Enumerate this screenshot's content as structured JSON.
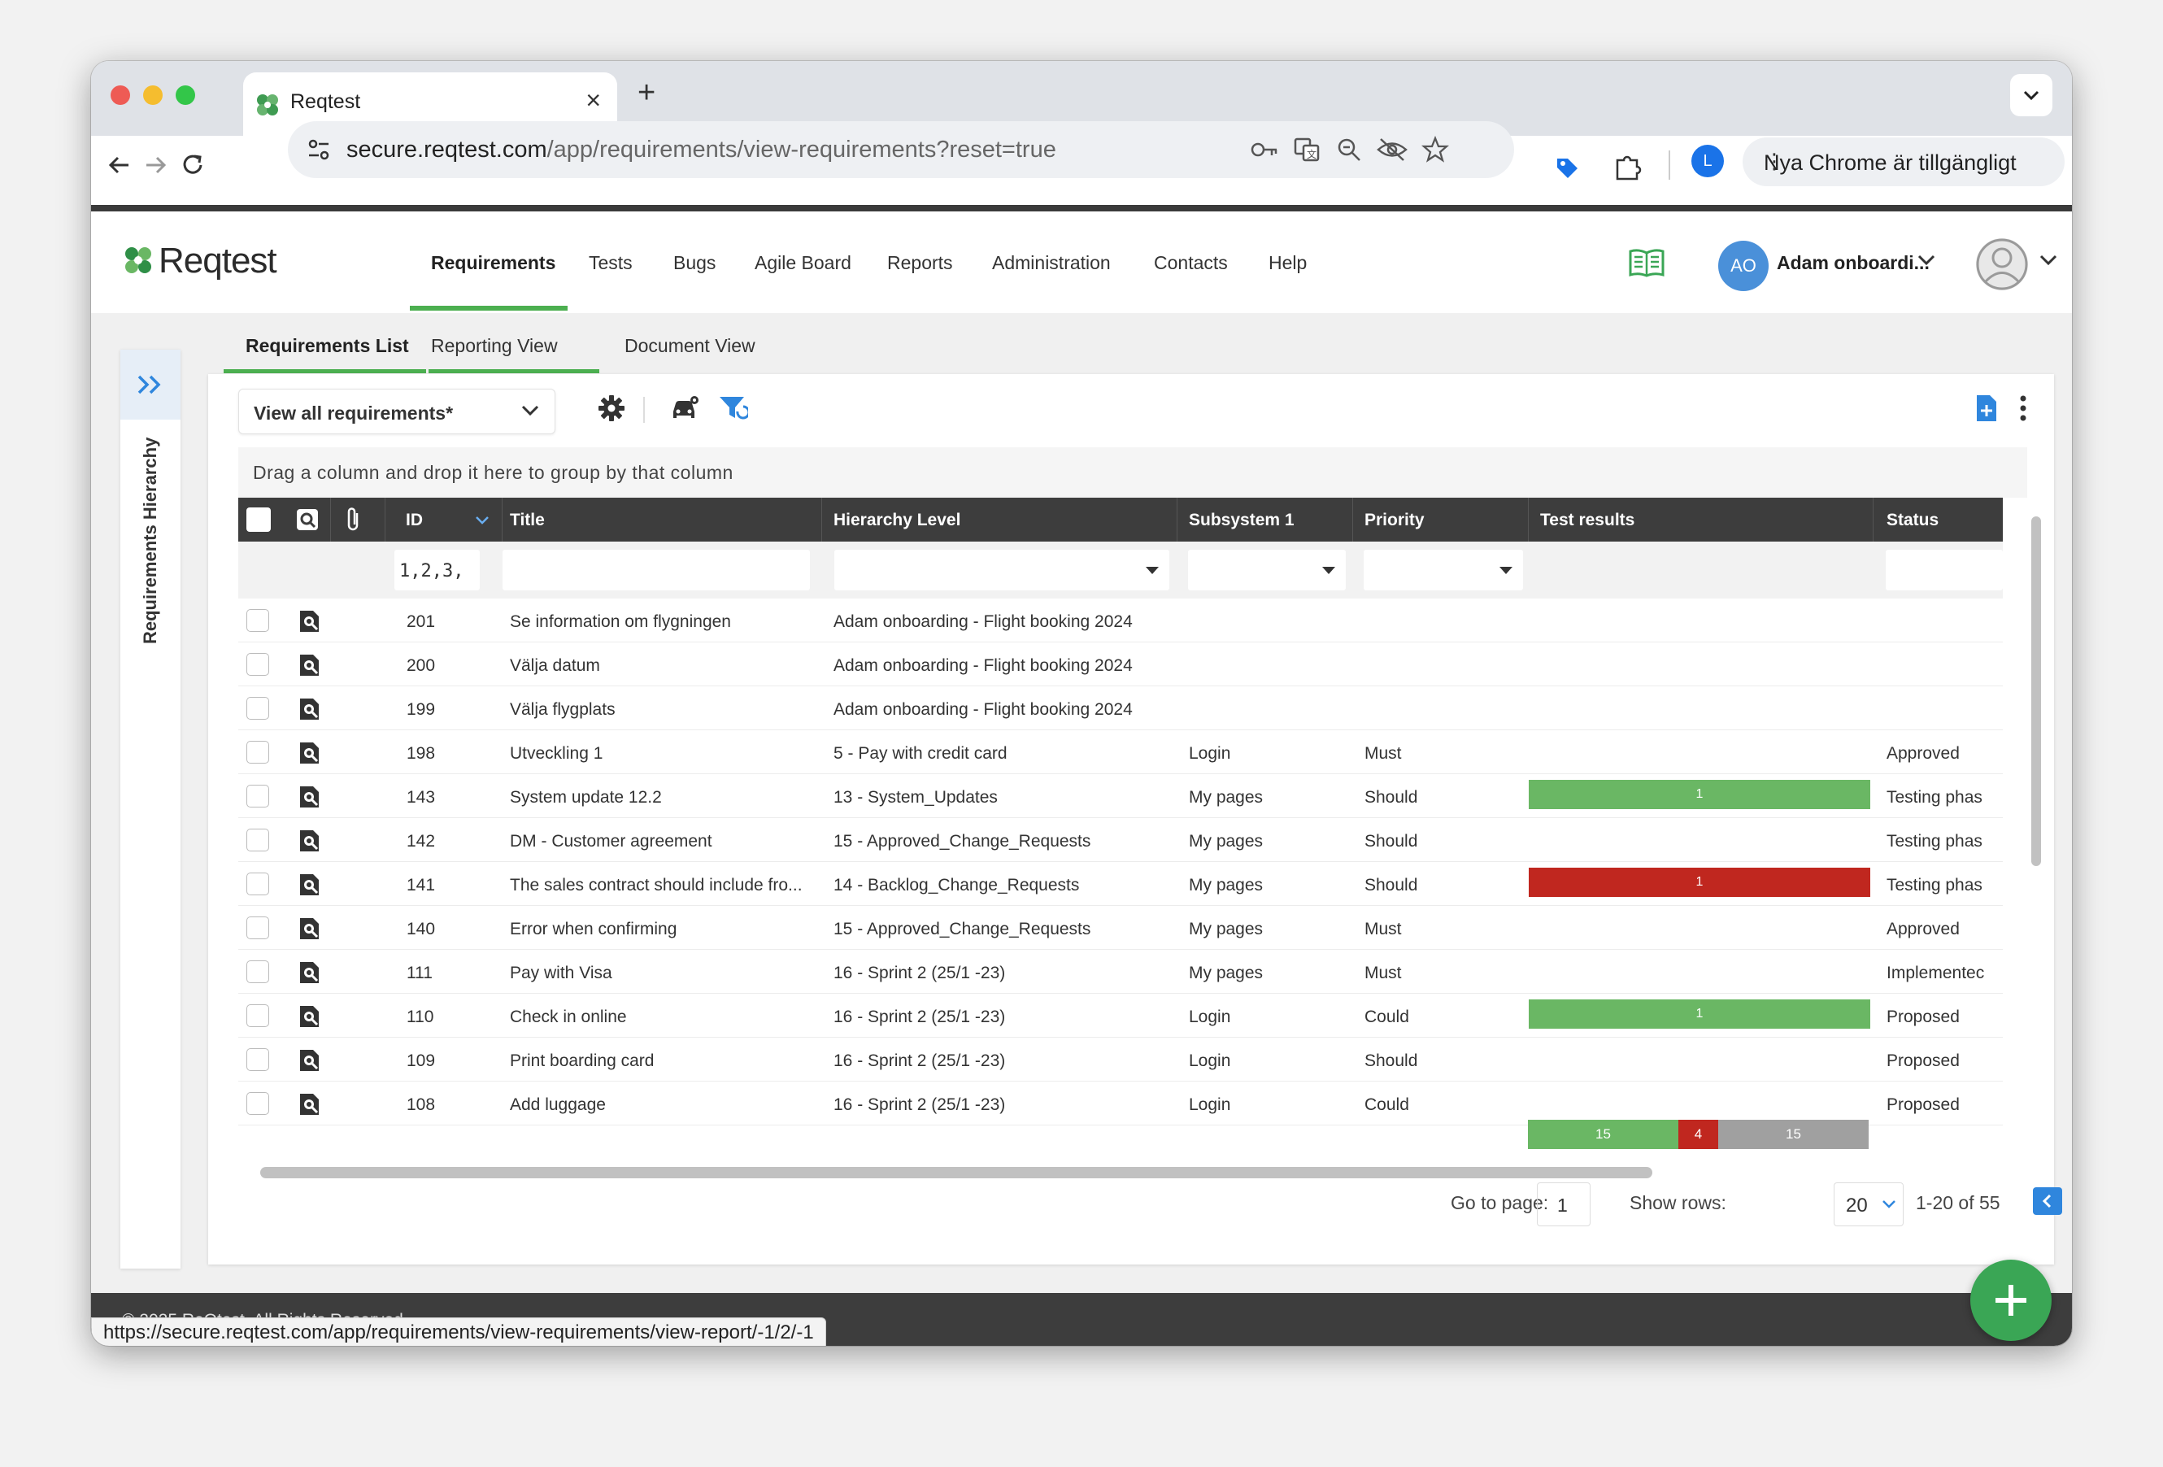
{
  "browser": {
    "tab_title": "Reqtest",
    "url_domain": "secure.reqtest.com",
    "url_path": "/app/requirements/view-requirements?reset=true",
    "profile_initial": "L",
    "update_label": "Nya Chrome är tillgängligt",
    "status_url": "https://secure.reqtest.com/app/requirements/view-requirements/view-report/-1/2/-1"
  },
  "app": {
    "logo_text": "Reqtest",
    "nav": [
      "Requirements",
      "Tests",
      "Bugs",
      "Agile Board",
      "Reports",
      "Administration",
      "Contacts",
      "Help"
    ],
    "active_nav": "Requirements",
    "user_initials": "AO",
    "user_name": "Adam onboardi...",
    "sidebar_label": "Requirements Hierarchy",
    "subtabs": [
      "Requirements List",
      "Reporting View",
      "Document View"
    ],
    "view_select": "View all requirements*",
    "group_hint": "Drag a column and drop it here to group by that column",
    "footer_text": "© 2025 ReQtest. All Rights Reserved"
  },
  "grid": {
    "columns": [
      "ID",
      "Title",
      "Hierarchy Level",
      "Subsystem 1",
      "Priority",
      "Test results",
      "Status"
    ],
    "id_filter": "1,2,3,",
    "rows": [
      {
        "id": "201",
        "title": "Se information om flygningen",
        "level": "Adam onboarding - Flight booking 2024",
        "subsystem": "",
        "priority": "",
        "status": ""
      },
      {
        "id": "200",
        "title": "Välja datum",
        "level": "Adam onboarding - Flight booking 2024",
        "subsystem": "",
        "priority": "",
        "status": ""
      },
      {
        "id": "199",
        "title": "Välja flygplats",
        "level": "Adam onboarding - Flight booking 2024",
        "subsystem": "",
        "priority": "",
        "status": ""
      },
      {
        "id": "198",
        "title": "Utveckling 1",
        "level": "5 - Pay with credit card",
        "subsystem": "Login",
        "priority": "Must",
        "status": "Approved"
      },
      {
        "id": "143",
        "title": "System update 12.2",
        "level": "13 - System_Updates",
        "subsystem": "My pages",
        "priority": "Should",
        "status": "Testing phas"
      },
      {
        "id": "142",
        "title": "DM - Customer agreement",
        "level": "15 - Approved_Change_Requests",
        "subsystem": "My pages",
        "priority": "Should",
        "status": "Testing phas"
      },
      {
        "id": "141",
        "title": "The sales contract should include fro...",
        "level": "14 - Backlog_Change_Requests",
        "subsystem": "My pages",
        "priority": "Should",
        "status": "Testing phas"
      },
      {
        "id": "140",
        "title": "Error when confirming",
        "level": "15 - Approved_Change_Requests",
        "subsystem": "My pages",
        "priority": "Must",
        "status": "Approved"
      },
      {
        "id": "111",
        "title": "Pay with Visa",
        "level": "16 - Sprint 2 (25/1 -23)",
        "subsystem": "My pages",
        "priority": "Must",
        "status": "Implementec"
      },
      {
        "id": "110",
        "title": "Check in online",
        "level": "16 - Sprint 2 (25/1 -23)",
        "subsystem": "Login",
        "priority": "Could",
        "status": "Proposed"
      },
      {
        "id": "109",
        "title": "Print boarding card",
        "level": "16 - Sprint 2 (25/1 -23)",
        "subsystem": "Login",
        "priority": "Should",
        "status": "Proposed"
      },
      {
        "id": "108",
        "title": "Add luggage",
        "level": "16 - Sprint 2 (25/1 -23)",
        "subsystem": "Login",
        "priority": "Could",
        "status": "Proposed"
      }
    ],
    "test_bars": [
      {
        "row": 4,
        "value": "1",
        "color": "#6ab764"
      },
      {
        "row": 6,
        "value": "1",
        "color": "#c0271f"
      },
      {
        "row": 9,
        "value": "1",
        "color": "#6ab764"
      }
    ],
    "summary": [
      {
        "value": "15",
        "color": "#6ab764"
      },
      {
        "value": "4",
        "color": "#c0271f"
      },
      {
        "value": "15",
        "color": "#a0a0a0"
      }
    ]
  },
  "pager": {
    "goto_label": "Go to page:",
    "page": "1",
    "rows_label": "Show rows:",
    "rows": "20",
    "range": "1-20 of 55"
  }
}
